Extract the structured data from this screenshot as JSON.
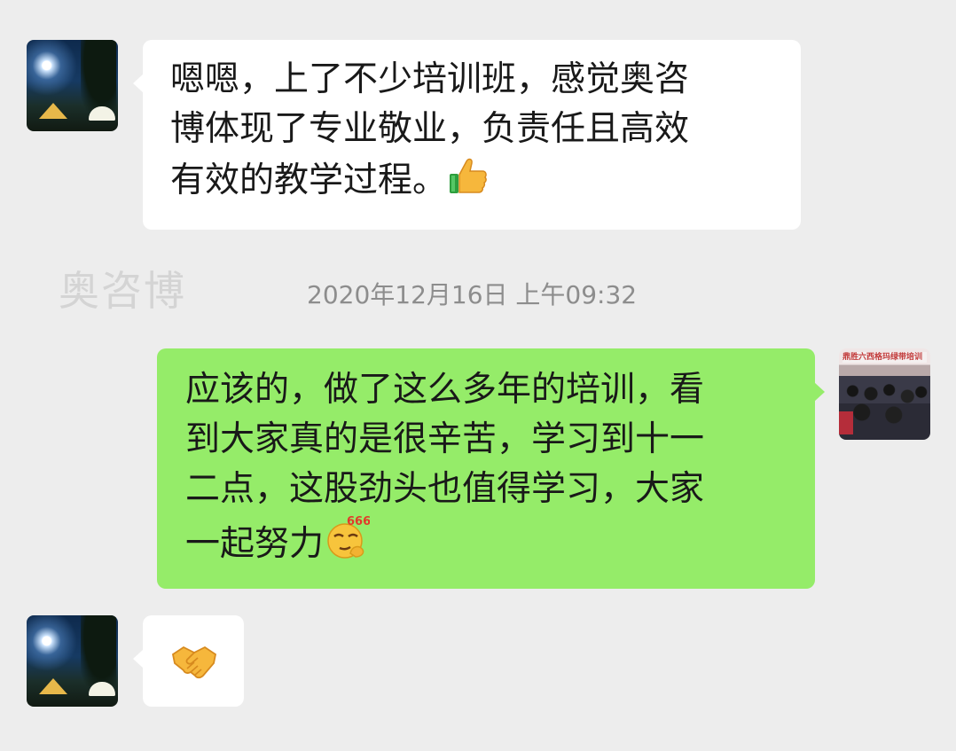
{
  "messages": [
    {
      "side": "left",
      "text": "嗯嗯，上了不少培训班，感觉奥咨博体现了专业敬业，负责任且高效有效的教学过程。",
      "line1": "嗯嗯，上了不少培训班，感觉奥咨",
      "line2": "博体现了专业敬业，负责任且高效",
      "line3": "有效的教学过程。",
      "emoji": "thumbs-up-icon"
    },
    {
      "side": "right",
      "line1": "应该的，做了这么多年的培训，看",
      "line2": "到大家真的是很辛苦，学习到十一",
      "line3": "二点，这股劲头也值得学习，大家",
      "line4": "一起努力",
      "emoji": "666-emoji-icon",
      "emoji_text": "666"
    },
    {
      "side": "left",
      "emoji": "handshake-icon"
    }
  ],
  "watermark": "奥咨博",
  "timestamp": "2020年12月16日 上午09:32",
  "avatar_right_banner": "鼎胜六西格玛绿带培训",
  "colors": {
    "background": "#ededed",
    "bubble_self": "#95ec69",
    "bubble_other": "#ffffff"
  }
}
